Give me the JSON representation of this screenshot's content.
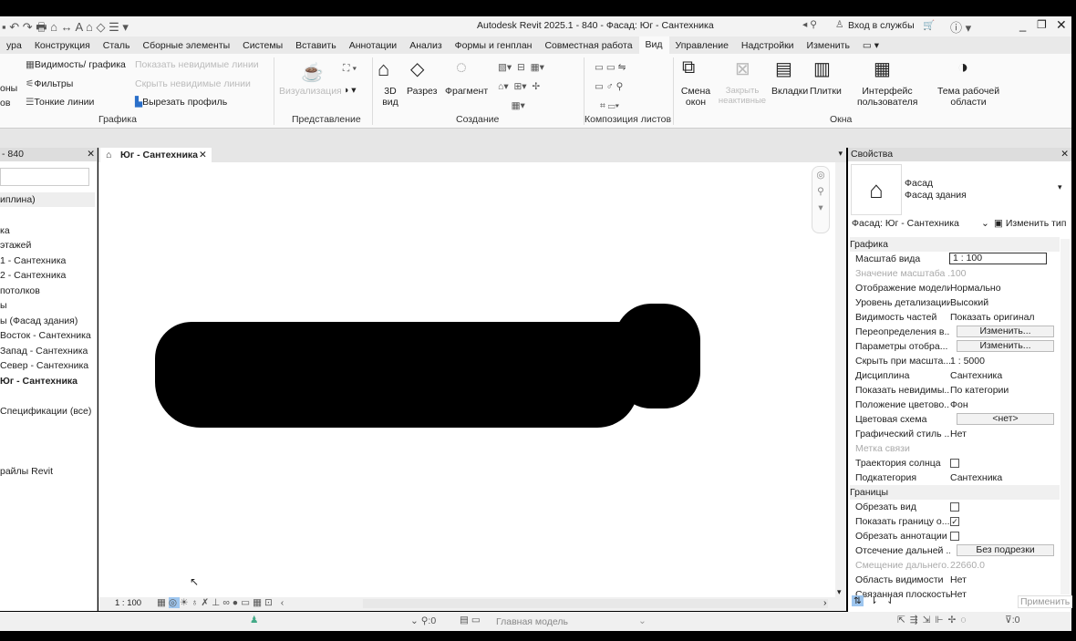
{
  "title": "Autodesk Revit 2025.1 - 840 - Фасад: Юг - Сантехника",
  "signin": "Вход в службы",
  "menu_tabs": [
    "ура",
    "Конструкция",
    "Сталь",
    "Сборные элементы",
    "Системы",
    "Вставить",
    "Аннотации",
    "Анализ",
    "Формы и генплан",
    "Совместная работа",
    "Вид",
    "Управление",
    "Надстройки",
    "Изменить"
  ],
  "ribbon": {
    "left_cut": [
      "оны",
      "ов"
    ],
    "graphics": {
      "vis": "Видимость/ графика",
      "filters": "Фильтры",
      "thin": "Тонкие линии",
      "show_hidden": "Показать невидимые линии",
      "hide_hidden": "Скрыть невидимые линии",
      "cut_profile": "Вырезать профиль",
      "label": "Графика"
    },
    "presentation": {
      "render": "Визуализация",
      "label": "Представление"
    },
    "create": {
      "view3d": "3D вид",
      "section": "Разрез",
      "callout": "Фрагмент",
      "label": "Создание"
    },
    "sheet": {
      "label": "Композиция листов"
    },
    "windows": {
      "switch": "Смена окон",
      "close": "Закрыть неактивные",
      "tabs": "Вкладки",
      "tile": "Плитки",
      "ui": "Интерфейс пользователя",
      "theme": "Тема рабочей области",
      "label": "Окна"
    }
  },
  "browser": {
    "title": "- 840",
    "items": [
      "иплина)",
      "ка",
      "этажей",
      "1 - Сантехника",
      "2 - Сантехника",
      "потолков",
      "ы",
      "ы (Фасад здания)",
      "Восток - Сантехника",
      "Запад - Сантехника",
      "Север - Сантехника",
      "Юг - Сантехника",
      "Спецификации (все)",
      "райлы Revit"
    ]
  },
  "doc_tab": "Юг - Сантехника",
  "viewbar": {
    "scale": "1 : 100"
  },
  "status": {
    "count": ":0",
    "model": "Главная модель",
    "filter": ":0"
  },
  "props": {
    "title": "Свойства",
    "family": "Фасад",
    "type": "Фасад здания",
    "selector": "Фасад: Юг - Сантехника",
    "edit_type": "Изменить тип",
    "groups": [
      {
        "name": "Графика",
        "rows": [
          {
            "k": "Масштаб вида",
            "v": "1 : 100",
            "kind": "input"
          },
          {
            "k": "Значение масштаба ...",
            "v": "100",
            "kind": "dis"
          },
          {
            "k": "Отображение модели",
            "v": "Нормально"
          },
          {
            "k": "Уровень детализации",
            "v": "Высокий"
          },
          {
            "k": "Видимость частей",
            "v": "Показать оригинал"
          },
          {
            "k": "Переопределения в...",
            "v": "Изменить...",
            "kind": "btn"
          },
          {
            "k": "Параметры отобра...",
            "v": "Изменить...",
            "kind": "btn"
          },
          {
            "k": "Скрыть при масшта...",
            "v": "1 : 5000"
          },
          {
            "k": "Дисциплина",
            "v": "Сантехника"
          },
          {
            "k": "Показать невидимы...",
            "v": "По категории"
          },
          {
            "k": "Положение цветово...",
            "v": "Фон"
          },
          {
            "k": "Цветовая схема",
            "v": "<нет>",
            "kind": "btn"
          },
          {
            "k": "Графический стиль ...",
            "v": "Нет"
          },
          {
            "k": "Метка связи",
            "v": "",
            "kind": "dis"
          },
          {
            "k": "Траектория солнца",
            "v": "",
            "kind": "cb"
          },
          {
            "k": "Подкатегория",
            "v": "Сантехника"
          }
        ]
      },
      {
        "name": "Границы",
        "rows": [
          {
            "k": "Обрезать вид",
            "v": "",
            "kind": "cb"
          },
          {
            "k": "Показать границу о...",
            "v": "✓",
            "kind": "cb"
          },
          {
            "k": "Обрезать аннотации",
            "v": "",
            "kind": "cb"
          },
          {
            "k": "Отсечение дальней ...",
            "v": "Без подрезки",
            "kind": "btn"
          },
          {
            "k": "Смещение дальнего...",
            "v": "22660.0",
            "kind": "dis"
          },
          {
            "k": "Область видимости",
            "v": "Нет"
          },
          {
            "k": "Связанная плоскость",
            "v": "Нет"
          }
        ]
      }
    ],
    "apply": "Применить"
  }
}
